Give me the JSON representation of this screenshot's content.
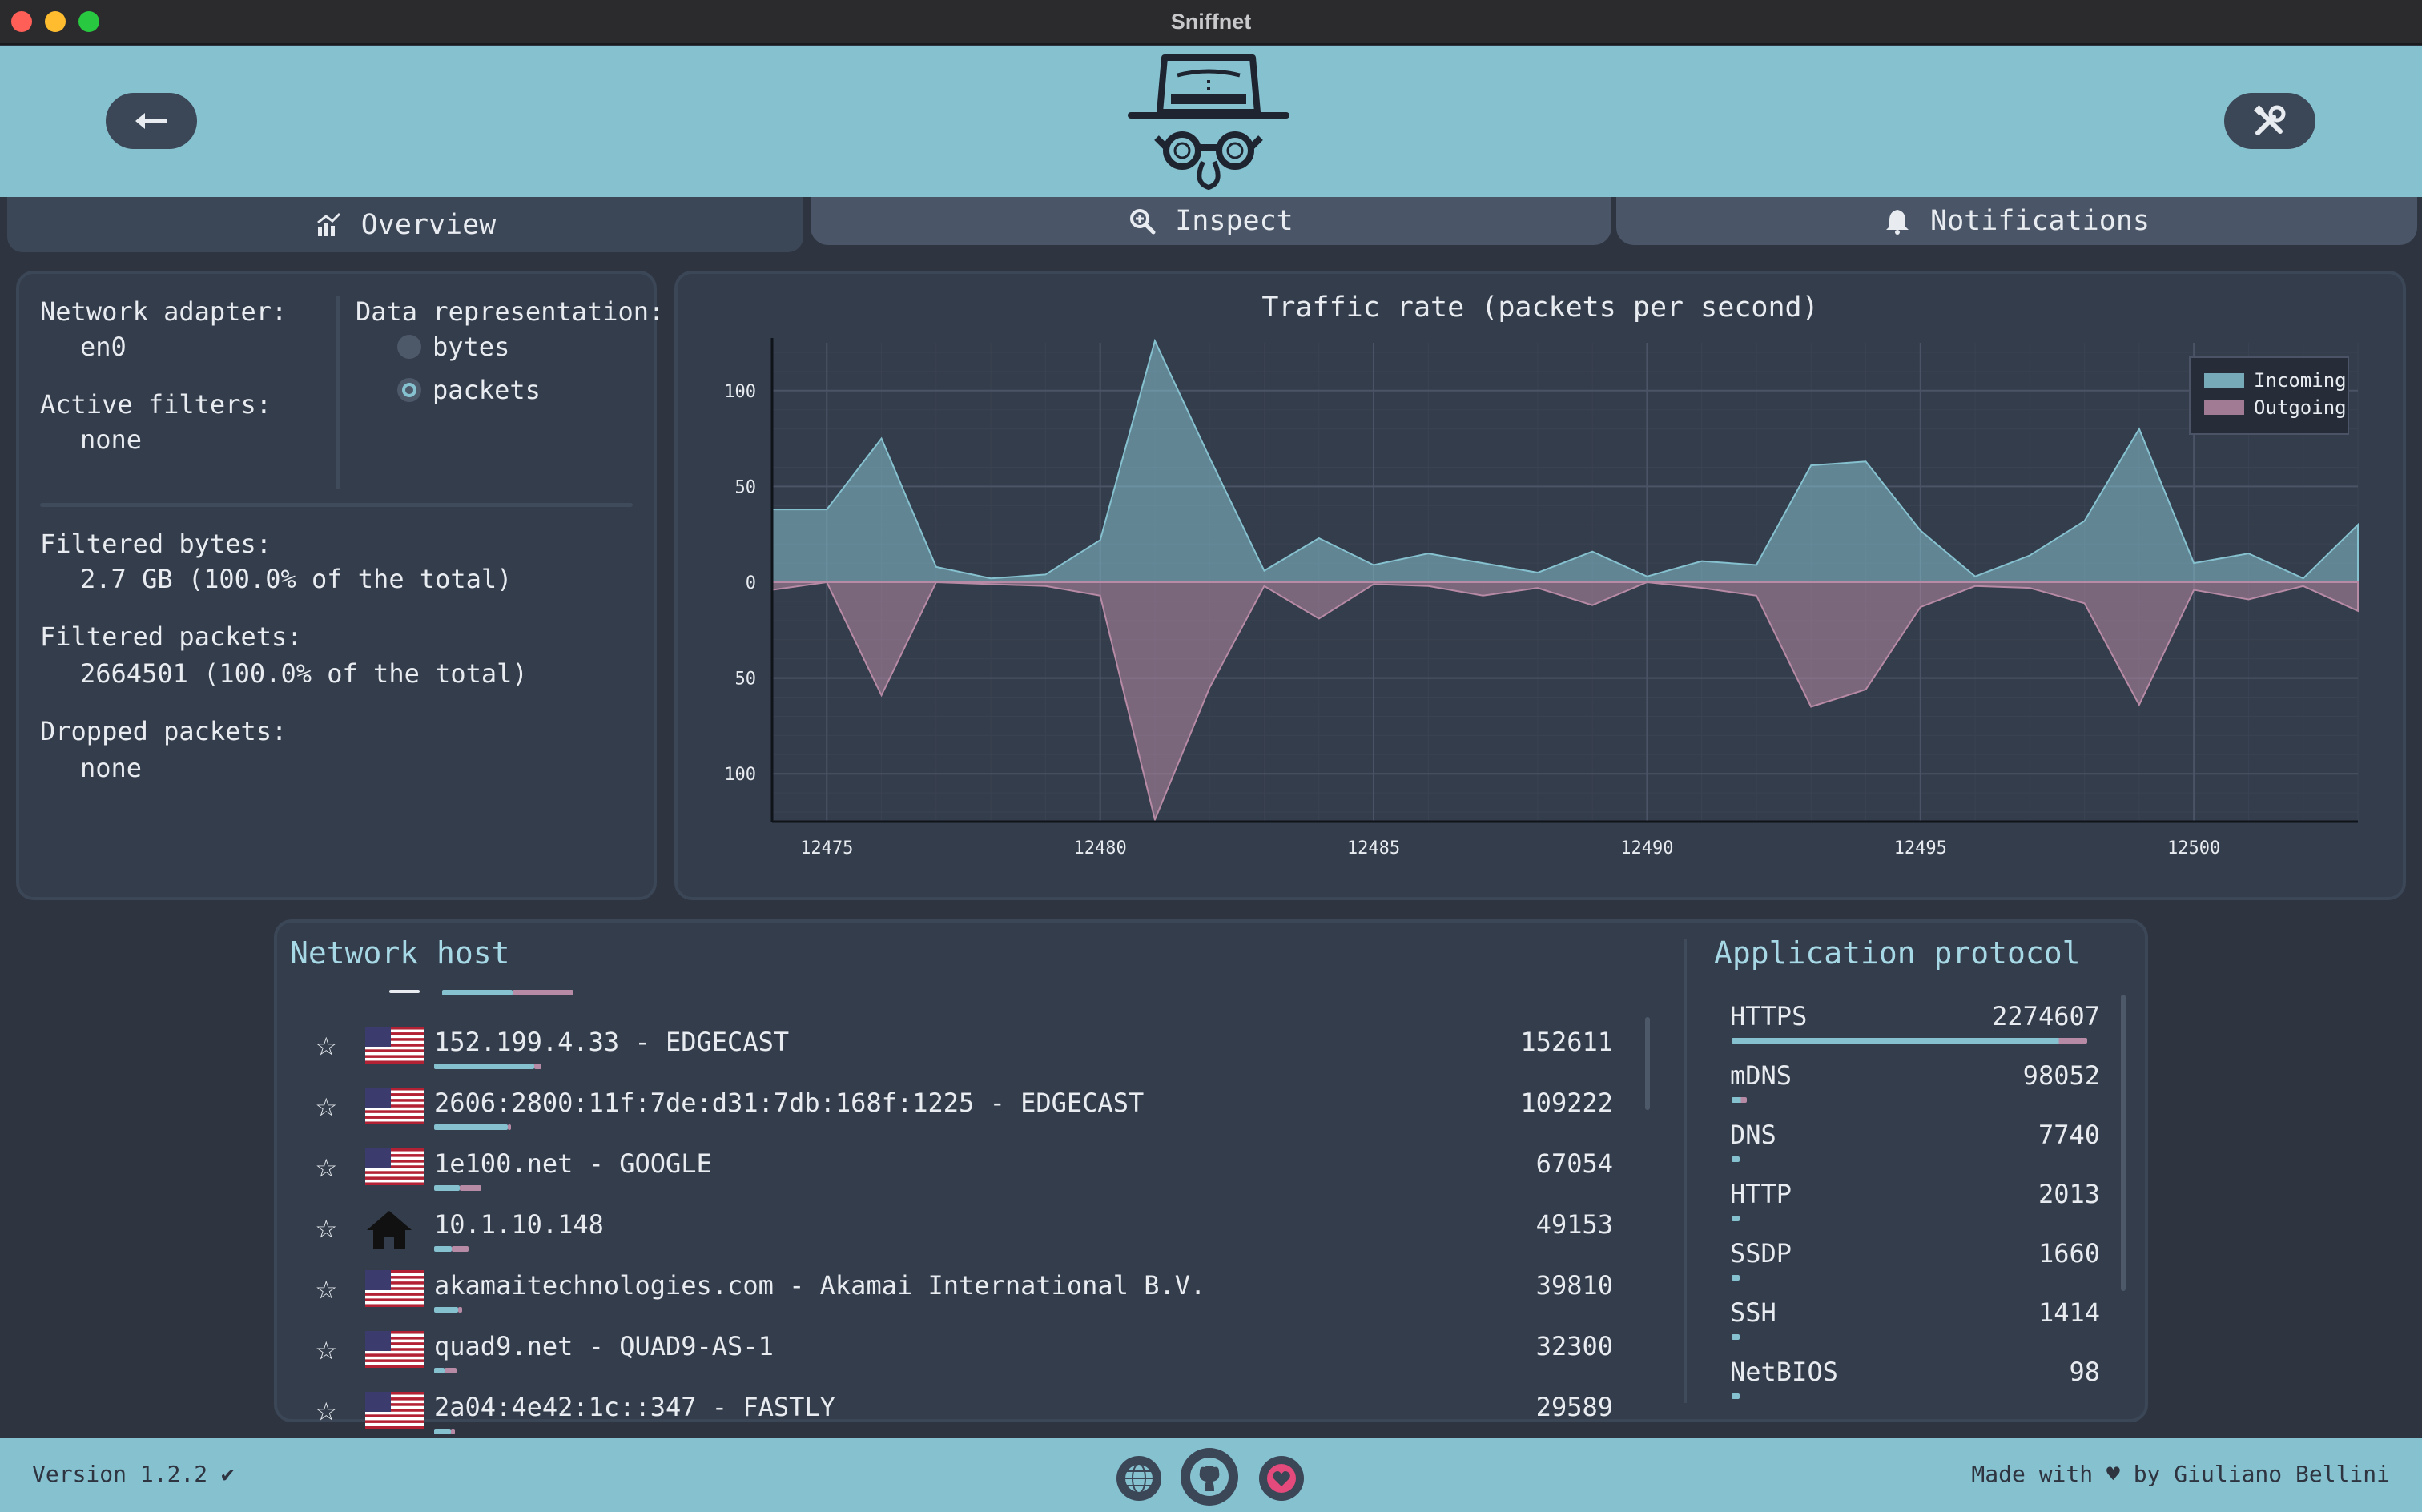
{
  "window": {
    "title": "Sniffnet"
  },
  "tabs": [
    {
      "label": "Overview",
      "icon": "chart-icon",
      "active": true
    },
    {
      "label": "Inspect",
      "icon": "magnifier-icon",
      "active": false
    },
    {
      "label": "Notifications",
      "icon": "bell-icon",
      "active": false
    }
  ],
  "overview": {
    "adapter_label": "Network adapter:",
    "adapter_value": "en0",
    "filters_label": "Active filters:",
    "filters_value": "none",
    "representation_label": "Data representation:",
    "representation_options": [
      "bytes",
      "packets"
    ],
    "representation_selected": "packets",
    "filtered_bytes_label": "Filtered bytes:",
    "filtered_bytes_value": "2.7 GB (100.0% of the total)",
    "filtered_packets_label": "Filtered packets:",
    "filtered_packets_value": "2664501 (100.0% of the total)",
    "dropped_label": "Dropped packets:",
    "dropped_value": "none"
  },
  "chart_data": {
    "type": "area",
    "title": "Traffic rate (packets per second)",
    "xlabel": "",
    "ylabel": "",
    "x_ticks": [
      "12475",
      "12480",
      "12485",
      "12490",
      "12495",
      "12500"
    ],
    "y_ticks": [
      "100",
      "50",
      "0",
      "50",
      "100"
    ],
    "xlim": [
      12474,
      12503
    ],
    "ylim": [
      -125,
      125
    ],
    "grid": true,
    "legend_placement": "top-right",
    "x": [
      12474,
      12475,
      12476,
      12477,
      12478,
      12479,
      12480,
      12481,
      12482,
      12483,
      12484,
      12485,
      12486,
      12487,
      12488,
      12489,
      12490,
      12491,
      12492,
      12493,
      12494,
      12495,
      12496,
      12497,
      12498,
      12499,
      12500,
      12501,
      12502,
      12503
    ],
    "series": [
      {
        "name": "Incoming",
        "color": "#86c1d0",
        "values": [
          38,
          38,
          75,
          8,
          2,
          4,
          22,
          126,
          65,
          6,
          23,
          9,
          15,
          10,
          5,
          16,
          3,
          11,
          9,
          61,
          63,
          27,
          3,
          14,
          32,
          80,
          10,
          15,
          2,
          30
        ]
      },
      {
        "name": "Outgoing",
        "color": "#b78aa5",
        "values": [
          -4,
          0,
          -59,
          0,
          -1,
          -2,
          -7,
          -124,
          -55,
          -2,
          -19,
          -1,
          -2,
          -7,
          -3,
          -12,
          0,
          -3,
          -7,
          -65,
          -56,
          -13,
          -2,
          -3,
          -11,
          -64,
          -4,
          -9,
          -2,
          -15
        ]
      }
    ]
  },
  "hosts": {
    "title": "Network host",
    "items": [
      {
        "name": "152.199.4.33 - EDGECAST",
        "value": "152611",
        "flag": "us-flag",
        "in_frac": 0.93,
        "out_frac": 0.07
      },
      {
        "name": "2606:2800:11f:7de:d31:7db:168f:1225 - EDGECAST",
        "value": "109222",
        "flag": "us-flag",
        "in_frac": 0.96,
        "out_frac": 0.04
      },
      {
        "name": "1e100.net - GOOGLE",
        "value": "67054",
        "flag": "us-flag",
        "in_frac": 0.55,
        "out_frac": 0.45
      },
      {
        "name": "10.1.10.148",
        "value": "49153",
        "flag": "home-icon",
        "in_frac": 0.5,
        "out_frac": 0.5
      },
      {
        "name": "akamaitechnologies.com - Akamai International B.V.",
        "value": "39810",
        "flag": "us-flag",
        "in_frac": 0.85,
        "out_frac": 0.15
      },
      {
        "name": "quad9.net - QUAD9-AS-1",
        "value": "32300",
        "flag": "us-flag",
        "in_frac": 0.45,
        "out_frac": 0.55
      },
      {
        "name": "2a04:4e42:1c::347 - FASTLY",
        "value": "29589",
        "flag": "us-flag",
        "in_frac": 0.8,
        "out_frac": 0.2
      }
    ]
  },
  "protocols": {
    "title": "Application protocol",
    "items": [
      {
        "name": "HTTPS",
        "value": "2274607",
        "share": 1.0
      },
      {
        "name": "mDNS",
        "value": "98052",
        "share": 0.043
      },
      {
        "name": "DNS",
        "value": "7740",
        "share": 0.0034
      },
      {
        "name": "HTTP",
        "value": "2013",
        "share": 0.0009
      },
      {
        "name": "SSDP",
        "value": "1660",
        "share": 0.0007
      },
      {
        "name": "SSH",
        "value": "1414",
        "share": 0.0006
      },
      {
        "name": "NetBIOS",
        "value": "98",
        "share": 4e-05
      }
    ]
  },
  "footer": {
    "version": "Version 1.2.2",
    "version_icon": "checkmark-icon",
    "made_with_prefix": "Made with",
    "made_with_suffix": "by Giuliano Bellini",
    "icons": [
      "globe-icon",
      "github-icon",
      "heart-icon"
    ]
  },
  "colors": {
    "header": "#86c1d0",
    "background": "#2e3440",
    "incoming": "#86c1d0",
    "outgoing": "#b78aa5"
  }
}
